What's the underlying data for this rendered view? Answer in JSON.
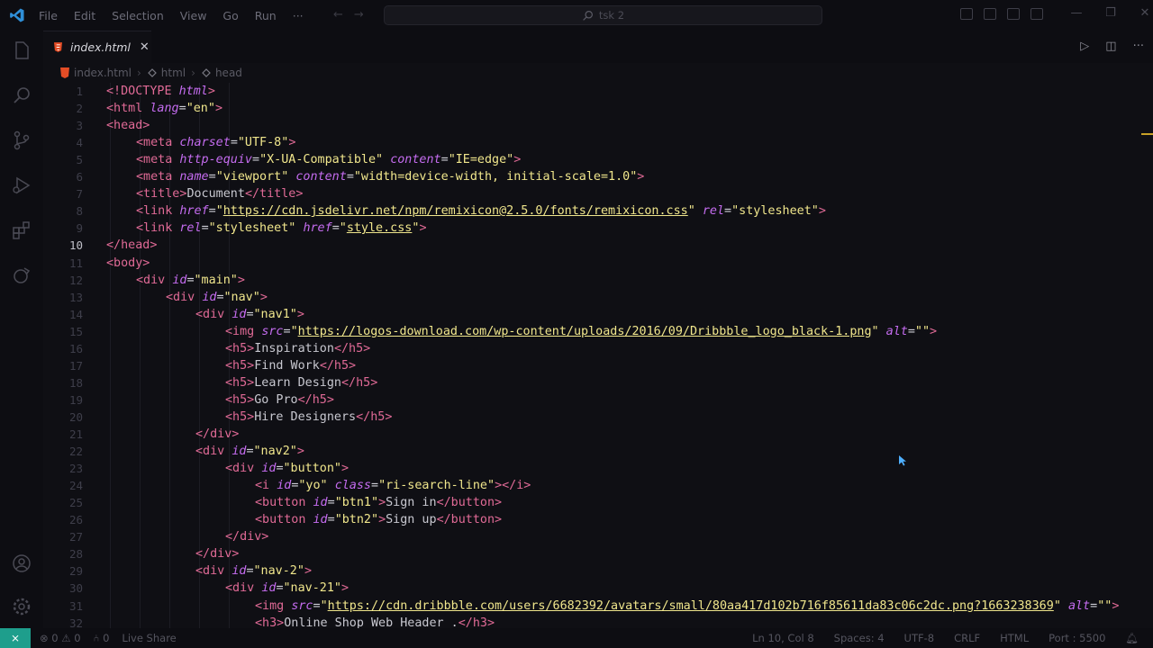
{
  "menu": [
    "File",
    "Edit",
    "Selection",
    "View",
    "Go",
    "Run",
    "···"
  ],
  "search": {
    "text": "tsk 2"
  },
  "tab": {
    "name": "index.html",
    "close": "✕"
  },
  "breadcrumb": [
    "index.html",
    "html",
    "head"
  ],
  "editor": {
    "active_line": 10,
    "lines": [
      [
        [
          "t",
          "<!DOCTYPE "
        ],
        [
          "a",
          "html"
        ],
        [
          "t",
          ">"
        ]
      ],
      [
        [
          "t",
          "<html "
        ],
        [
          "a",
          "lang"
        ],
        [
          "p",
          "="
        ],
        [
          "s",
          "\"en\""
        ],
        [
          "t",
          ">"
        ]
      ],
      [
        [
          "t",
          "<head>"
        ]
      ],
      [
        [
          "t",
          "<meta "
        ],
        [
          "a",
          "charset"
        ],
        [
          "p",
          "="
        ],
        [
          "s",
          "\"UTF-8\""
        ],
        [
          "t",
          ">"
        ]
      ],
      [
        [
          "t",
          "<meta "
        ],
        [
          "a",
          "http-equiv"
        ],
        [
          "p",
          "="
        ],
        [
          "s",
          "\"X-UA-Compatible\" "
        ],
        [
          "a",
          "content"
        ],
        [
          "p",
          "="
        ],
        [
          "s",
          "\"IE=edge\""
        ],
        [
          "t",
          ">"
        ]
      ],
      [
        [
          "t",
          "<meta "
        ],
        [
          "a",
          "name"
        ],
        [
          "p",
          "="
        ],
        [
          "s",
          "\"viewport\" "
        ],
        [
          "a",
          "content"
        ],
        [
          "p",
          "="
        ],
        [
          "s",
          "\"width=device-width, initial-scale=1.0\""
        ],
        [
          "t",
          ">"
        ]
      ],
      [
        [
          "t",
          "<title>"
        ],
        [
          "tx",
          "Document"
        ],
        [
          "t",
          "</title>"
        ]
      ],
      [
        [
          "t",
          "<link "
        ],
        [
          "a",
          "href"
        ],
        [
          "p",
          "="
        ],
        [
          "s",
          "\""
        ],
        [
          "u",
          "https://cdn.jsdelivr.net/npm/remixicon@2.5.0/fonts/remixicon.css"
        ],
        [
          "s",
          "\" "
        ],
        [
          "a",
          "rel"
        ],
        [
          "p",
          "="
        ],
        [
          "s",
          "\"stylesheet\""
        ],
        [
          "t",
          ">"
        ]
      ],
      [
        [
          "t",
          "<link "
        ],
        [
          "a",
          "rel"
        ],
        [
          "p",
          "="
        ],
        [
          "s",
          "\"stylesheet\" "
        ],
        [
          "a",
          "href"
        ],
        [
          "p",
          "="
        ],
        [
          "s",
          "\""
        ],
        [
          "u",
          "style.css"
        ],
        [
          "s",
          "\""
        ],
        [
          "t",
          ">"
        ]
      ],
      [
        [
          "t",
          "</head>"
        ]
      ],
      [
        [
          "t",
          "<body>"
        ]
      ],
      [
        [
          "t",
          "<div "
        ],
        [
          "a",
          "id"
        ],
        [
          "p",
          "="
        ],
        [
          "s",
          "\"main\""
        ],
        [
          "t",
          ">"
        ]
      ],
      [
        [
          "t",
          "<div "
        ],
        [
          "a",
          "id"
        ],
        [
          "p",
          "="
        ],
        [
          "s",
          "\"nav\""
        ],
        [
          "t",
          ">"
        ]
      ],
      [
        [
          "t",
          "<div "
        ],
        [
          "a",
          "id"
        ],
        [
          "p",
          "="
        ],
        [
          "s",
          "\"nav1\""
        ],
        [
          "t",
          ">"
        ]
      ],
      [
        [
          "t",
          "<img "
        ],
        [
          "a",
          "src"
        ],
        [
          "p",
          "="
        ],
        [
          "s",
          "\""
        ],
        [
          "u",
          "https://logos-download.com/wp-content/uploads/2016/09/Dribbble_logo_black-1.png"
        ],
        [
          "s",
          "\" "
        ],
        [
          "a",
          "alt"
        ],
        [
          "p",
          "="
        ],
        [
          "s",
          "\"\""
        ],
        [
          "t",
          ">"
        ]
      ],
      [
        [
          "t",
          "<h5>"
        ],
        [
          "tx",
          "Inspiration"
        ],
        [
          "t",
          "</h5>"
        ]
      ],
      [
        [
          "t",
          "<h5>"
        ],
        [
          "tx",
          "Find Work"
        ],
        [
          "t",
          "</h5>"
        ]
      ],
      [
        [
          "t",
          "<h5>"
        ],
        [
          "tx",
          "Learn Design"
        ],
        [
          "t",
          "</h5>"
        ]
      ],
      [
        [
          "t",
          "<h5>"
        ],
        [
          "tx",
          "Go Pro"
        ],
        [
          "t",
          "</h5>"
        ]
      ],
      [
        [
          "t",
          "<h5>"
        ],
        [
          "tx",
          "Hire Designers"
        ],
        [
          "t",
          "</h5>"
        ]
      ],
      [
        [
          "t",
          "</div>"
        ]
      ],
      [
        [
          "t",
          "<div "
        ],
        [
          "a",
          "id"
        ],
        [
          "p",
          "="
        ],
        [
          "s",
          "\"nav2\""
        ],
        [
          "t",
          ">"
        ]
      ],
      [
        [
          "t",
          "<div "
        ],
        [
          "a",
          "id"
        ],
        [
          "p",
          "="
        ],
        [
          "s",
          "\"button\""
        ],
        [
          "t",
          ">"
        ]
      ],
      [
        [
          "t",
          "<i "
        ],
        [
          "a",
          "id"
        ],
        [
          "p",
          "="
        ],
        [
          "s",
          "\"yo\" "
        ],
        [
          "a",
          "class"
        ],
        [
          "p",
          "="
        ],
        [
          "s",
          "\"ri-search-line\""
        ],
        [
          "t",
          "></i>"
        ]
      ],
      [
        [
          "t",
          "<button "
        ],
        [
          "a",
          "id"
        ],
        [
          "p",
          "="
        ],
        [
          "s",
          "\"btn1\""
        ],
        [
          "t",
          ">"
        ],
        [
          "tx",
          "Sign in"
        ],
        [
          "t",
          "</button>"
        ]
      ],
      [
        [
          "t",
          "<button "
        ],
        [
          "a",
          "id"
        ],
        [
          "p",
          "="
        ],
        [
          "s",
          "\"btn2\""
        ],
        [
          "t",
          ">"
        ],
        [
          "tx",
          "Sign up"
        ],
        [
          "t",
          "</button>"
        ]
      ],
      [
        [
          "t",
          "</div>"
        ]
      ],
      [
        [
          "t",
          "</div>"
        ]
      ],
      [
        [
          "t",
          "<div "
        ],
        [
          "a",
          "id"
        ],
        [
          "p",
          "="
        ],
        [
          "s",
          "\"nav-2\""
        ],
        [
          "t",
          ">"
        ]
      ],
      [
        [
          "t",
          "<div "
        ],
        [
          "a",
          "id"
        ],
        [
          "p",
          "="
        ],
        [
          "s",
          "\"nav-21\""
        ],
        [
          "t",
          ">"
        ]
      ],
      [
        [
          "t",
          "<img "
        ],
        [
          "a",
          "src"
        ],
        [
          "p",
          "="
        ],
        [
          "s",
          "\""
        ],
        [
          "u",
          "https://cdn.dribbble.com/users/6682392/avatars/small/80aa417d102b716f85611da83c06c2dc.png?1663238369"
        ],
        [
          "s",
          "\" "
        ],
        [
          "a",
          "alt"
        ],
        [
          "p",
          "="
        ],
        [
          "s",
          "\"\""
        ],
        [
          "t",
          ">"
        ]
      ],
      [
        [
          "t",
          "<h3>"
        ],
        [
          "tx",
          "Online Shop Web Header ."
        ],
        [
          "t",
          "</h3>"
        ]
      ]
    ]
  },
  "status": {
    "remote": "⨯",
    "errors": "⊗ 0 ⚠ 0",
    "ports": "⑃ 0",
    "live_share": "Live Share",
    "position": "Ln 10, Col 8",
    "spaces": "Spaces: 4",
    "encoding": "UTF-8",
    "eol": "CRLF",
    "language": "HTML",
    "port": "Port : 5500"
  },
  "colors": {
    "remote_bg": "#1e9e8c",
    "tag": "#e06a96",
    "attr": "#c56cf0",
    "string": "#f0e68c"
  }
}
